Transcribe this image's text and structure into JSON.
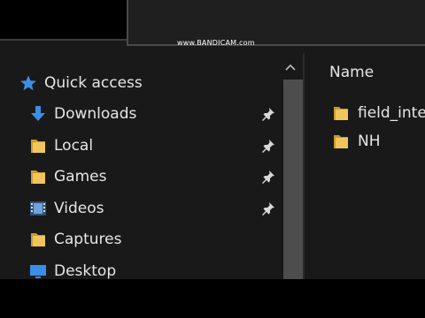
{
  "watermark": "www.BANDICAM.com",
  "sidebar": {
    "quick_access": "Quick access",
    "items": [
      {
        "label": "Downloads",
        "icon": "download-arrow-icon",
        "pinned": true
      },
      {
        "label": "Local",
        "icon": "folder-icon",
        "pinned": true
      },
      {
        "label": "Games",
        "icon": "folder-icon",
        "pinned": true
      },
      {
        "label": "Videos",
        "icon": "videos-icon",
        "pinned": true
      },
      {
        "label": "Captures",
        "icon": "folder-icon",
        "pinned": false
      },
      {
        "label": "Desktop",
        "icon": "desktop-icon",
        "pinned": false
      }
    ]
  },
  "content": {
    "column_header": "Name",
    "files": [
      {
        "name": "field_inter",
        "icon": "folder-icon"
      },
      {
        "name": "NH",
        "icon": "folder-icon"
      }
    ]
  },
  "colors": {
    "folder": "#f2c55c",
    "accent_blue": "#3a8ee6",
    "background": "#191919",
    "scrollbar_thumb": "#4d4d4d"
  }
}
